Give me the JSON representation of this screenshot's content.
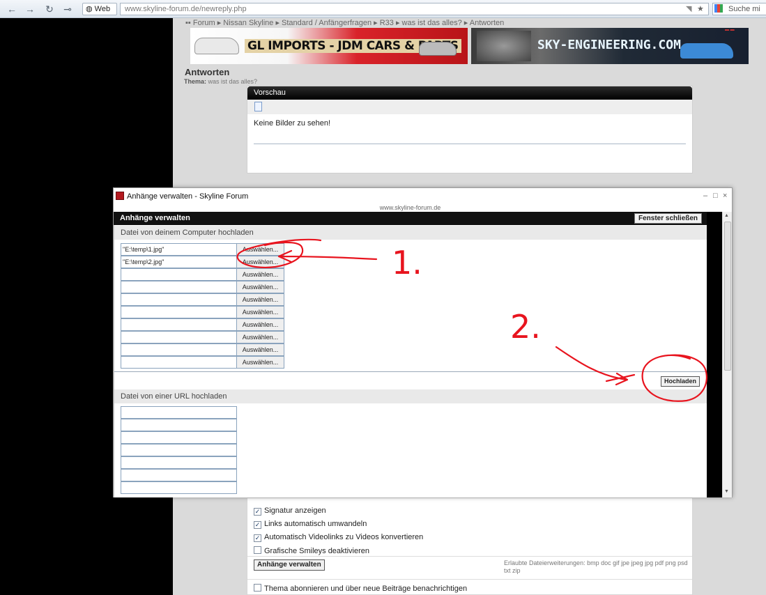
{
  "browser": {
    "web_chip": "Web",
    "url_domain": "www.skyline-forum.de",
    "url_path": "/newreply.php",
    "search_placeholder": "Suche mi"
  },
  "page": {
    "breadcrumb": "▪▪ Forum ▸ Nissan Skyline ▸ Standard / Anfängerfragen ▸ R33 ▸ was ist das alles? ▸ Antworten",
    "banner_left": "GL IMPORTS - JDM CARS & PARTS",
    "banner_right": "SKY-ENGINEERING.COM",
    "title": "Antworten",
    "thread_label": "Thema:",
    "thread_name": "was ist das alles?",
    "preview": {
      "heading": "Vorschau",
      "text": "Keine Bilder zu sehen!"
    },
    "options": [
      {
        "label": "Signatur anzeigen",
        "checked": true
      },
      {
        "label": "Links automatisch umwandeln",
        "checked": true
      },
      {
        "label": "Automatisch Videolinks zu Videos konvertieren",
        "checked": true
      },
      {
        "label": "Grafische Smileys deaktivieren",
        "checked": false
      }
    ],
    "attachments_button": "Anhänge verwalten",
    "allowed_extensions": "Erlaubte Dateierweiterungen: bmp doc gif jpe jpeg jpg pdf png psd txt zip",
    "subscribe_label": "Thema abonnieren und über neue Beiträge benachrichtigen"
  },
  "popup": {
    "window_title": "Anhänge verwalten - Skyline Forum",
    "url": "www.skyline-forum.de",
    "heading": "Anhänge verwalten",
    "close_button": "Fenster schließen",
    "upload_section": "Datei von deinem Computer hochladen",
    "files": [
      {
        "path": "\"E:\\temp\\1.jpg\"",
        "button": "Auswählen..."
      },
      {
        "path": "\"E:\\temp\\2.jpg\"",
        "button": "Auswählen..."
      },
      {
        "path": "",
        "button": "Auswählen..."
      },
      {
        "path": "",
        "button": "Auswählen..."
      },
      {
        "path": "",
        "button": "Auswählen..."
      },
      {
        "path": "",
        "button": "Auswählen..."
      },
      {
        "path": "",
        "button": "Auswählen..."
      },
      {
        "path": "",
        "button": "Auswählen..."
      },
      {
        "path": "",
        "button": "Auswählen..."
      },
      {
        "path": "",
        "button": "Auswählen..."
      }
    ],
    "upload_button": "Hochladen",
    "url_section": "Datei von einer URL hochladen",
    "url_fields": [
      "",
      "",
      "",
      "",
      "",
      "",
      ""
    ]
  },
  "annotations": {
    "step1": "1.",
    "step2": "2.",
    "color": "#e8141e"
  }
}
